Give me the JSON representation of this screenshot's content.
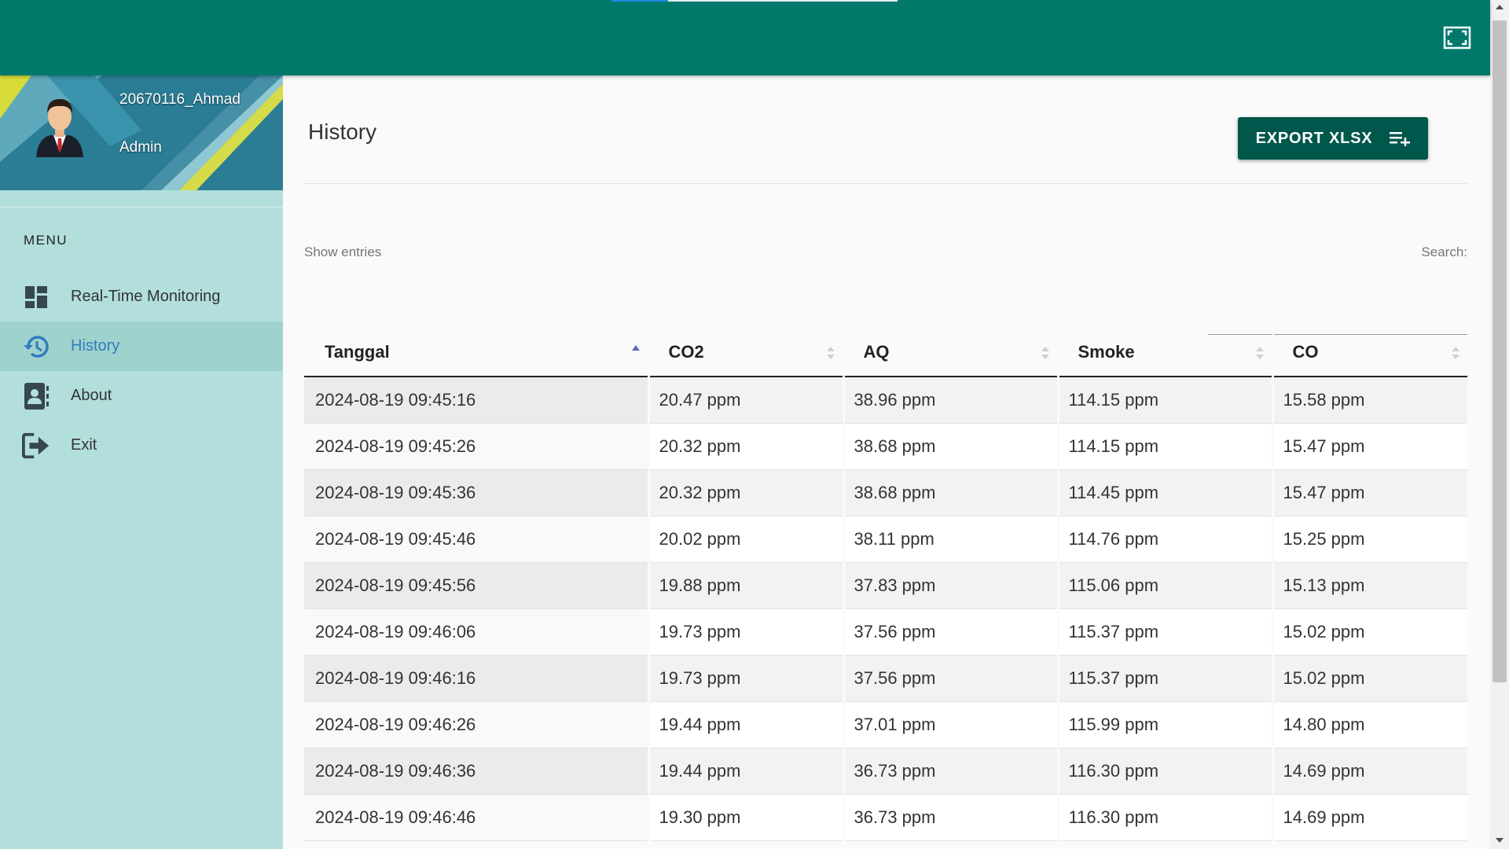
{
  "profile": {
    "name": "20670116_Ahmad",
    "role": "Admin"
  },
  "menu": {
    "header": "MENU",
    "items": [
      {
        "label": "Real-Time Monitoring",
        "icon": "dashboard-icon",
        "active": false
      },
      {
        "label": "History",
        "icon": "history-icon",
        "active": true
      },
      {
        "label": "About",
        "icon": "contact-card-icon",
        "active": false
      },
      {
        "label": "Exit",
        "icon": "exit-icon",
        "active": false
      }
    ]
  },
  "page": {
    "title": "History",
    "export_label": "EXPORT XLSX",
    "show_entries_label": "Show entries",
    "search_label": "Search:",
    "search_value": ""
  },
  "colors": {
    "topbar": "#00796b",
    "sidebar": "#b2dfdb",
    "export_button": "#00574b",
    "active_menu_text": "#2f7cc0"
  },
  "table": {
    "columns": [
      "Tanggal",
      "CO2",
      "AQ",
      "Smoke",
      "CO"
    ],
    "sorted_column": "Tanggal",
    "sort_direction": "ascending",
    "rows": [
      [
        "2024-08-19 09:45:16",
        "20.47 ppm",
        "38.96 ppm",
        "114.15 ppm",
        "15.58 ppm"
      ],
      [
        "2024-08-19 09:45:26",
        "20.32 ppm",
        "38.68 ppm",
        "114.15 ppm",
        "15.47 ppm"
      ],
      [
        "2024-08-19 09:45:36",
        "20.32 ppm",
        "38.68 ppm",
        "114.45 ppm",
        "15.47 ppm"
      ],
      [
        "2024-08-19 09:45:46",
        "20.02 ppm",
        "38.11 ppm",
        "114.76 ppm",
        "15.25 ppm"
      ],
      [
        "2024-08-19 09:45:56",
        "19.88 ppm",
        "37.83 ppm",
        "115.06 ppm",
        "15.13 ppm"
      ],
      [
        "2024-08-19 09:46:06",
        "19.73 ppm",
        "37.56 ppm",
        "115.37 ppm",
        "15.02 ppm"
      ],
      [
        "2024-08-19 09:46:16",
        "19.73 ppm",
        "37.56 ppm",
        "115.37 ppm",
        "15.02 ppm"
      ],
      [
        "2024-08-19 09:46:26",
        "19.44 ppm",
        "37.01 ppm",
        "115.99 ppm",
        "14.80 ppm"
      ],
      [
        "2024-08-19 09:46:36",
        "19.44 ppm",
        "36.73 ppm",
        "116.30 ppm",
        "14.69 ppm"
      ],
      [
        "2024-08-19 09:46:46",
        "19.30 ppm",
        "36.73 ppm",
        "116.30 ppm",
        "14.69 ppm"
      ]
    ]
  }
}
